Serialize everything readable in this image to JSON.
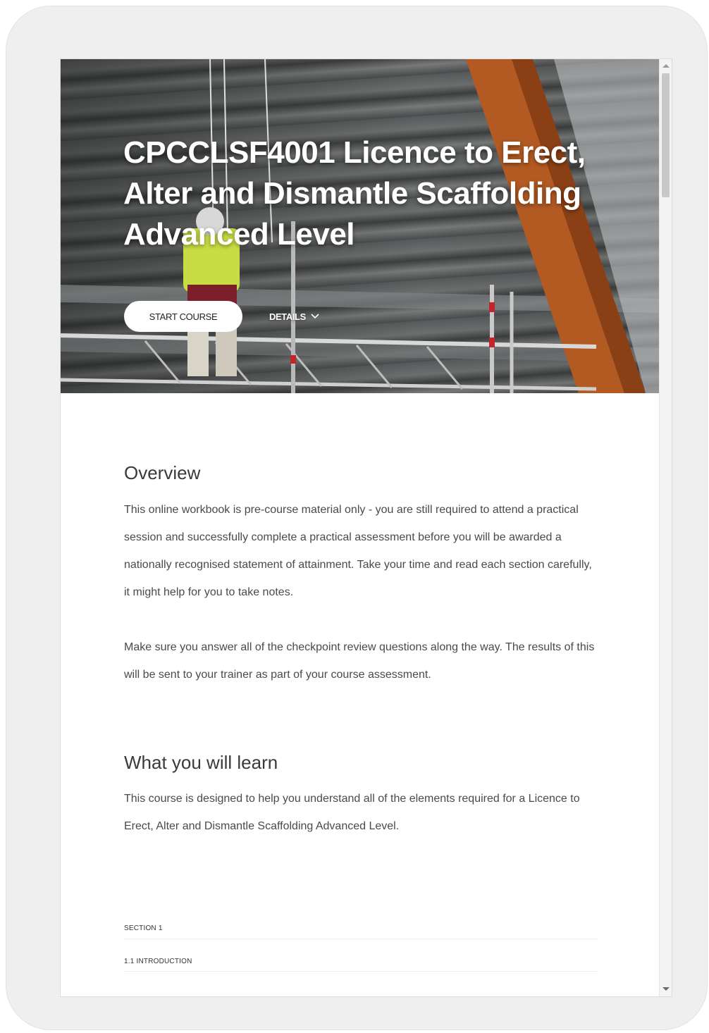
{
  "hero": {
    "title": "CPCCLSF4001 Licence to Erect, Alter and Dismantle Scaffolding Advanced Level",
    "start_label": "START COURSE",
    "details_label": "DETAILS"
  },
  "overview": {
    "heading": "Overview",
    "body": "This online workbook is pre-course material only - you are still required to attend a practical session and successfully complete a practical assessment before you will be awarded a nationally recognised statement of attainment. Take your time and read each section carefully, it might help for you to take notes.",
    "body2": "Make sure you answer all of the checkpoint review questions along the way. The results of this will be sent to your trainer as part of your course assessment."
  },
  "learn": {
    "heading": "What you will learn",
    "body": "This course is designed to help you understand all of the elements required for a Licence to Erect, Alter and Dismantle Scaffolding Advanced Level."
  },
  "outline": {
    "section_label": "SECTION 1",
    "lesson_label": "1.1 INTRODUCTION"
  },
  "icons": {
    "details_chevron": "chevron-down-icon",
    "scroll_up": "scroll-up-arrow-icon",
    "scroll_down": "scroll-down-arrow-icon"
  }
}
